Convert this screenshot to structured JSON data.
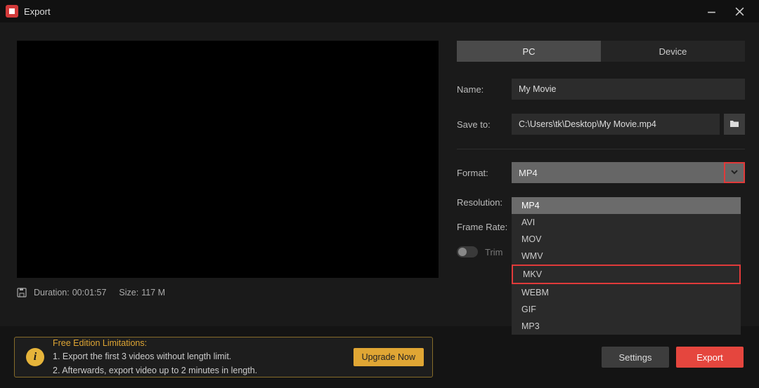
{
  "window": {
    "title": "Export"
  },
  "tabs": {
    "pc": "PC",
    "device": "Device"
  },
  "fields": {
    "name_label": "Name:",
    "name_value": "My Movie",
    "saveto_label": "Save to:",
    "saveto_value": "C:\\Users\\tk\\Desktop\\My Movie.mp4",
    "format_label": "Format:",
    "format_value": "MP4",
    "resolution_label": "Resolution:",
    "framerate_label": "Frame Rate:",
    "trim_label": "Trim"
  },
  "format_options": [
    "MP4",
    "AVI",
    "MOV",
    "WMV",
    "MKV",
    "WEBM",
    "GIF",
    "MP3"
  ],
  "format_selected": "MP4",
  "format_highlighted": "MKV",
  "meta": {
    "duration_label": "Duration:",
    "duration_value": "00:01:57",
    "size_label": "Size:",
    "size_value": "117 M"
  },
  "notice": {
    "title": "Free Edition Limitations:",
    "line1": "1. Export the first 3 videos without length limit.",
    "line2": "2. Afterwards, export video up to 2 minutes in length.",
    "upgrade": "Upgrade Now"
  },
  "buttons": {
    "settings": "Settings",
    "export": "Export"
  }
}
